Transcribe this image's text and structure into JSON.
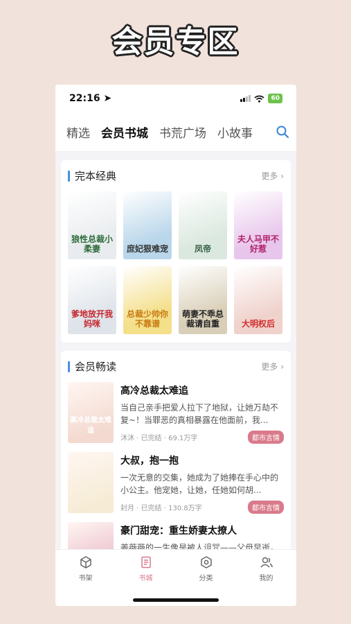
{
  "banner": "会员专区",
  "status": {
    "time": "22:16",
    "battery": "60"
  },
  "tabs": [
    "精选",
    "会员书城",
    "书荒广场",
    "小故事"
  ],
  "section1": {
    "title": "完本经典",
    "more": "更多",
    "books": [
      {
        "title": "狼性总裁小柔妻",
        "bg": "#e9ecef",
        "color": "#2c6b3a"
      },
      {
        "title": "庶妃狠难宠",
        "bg": "#b9d6ea",
        "color": "#333"
      },
      {
        "title": "凤帝",
        "bg": "#dbe8df",
        "color": "#355f45"
      },
      {
        "title": "夫人马甲不好惹",
        "bg": "#e8c6ec",
        "color": "#b0246a"
      },
      {
        "title": "爹地放开我妈咪",
        "bg": "#dfe4ea",
        "color": "#c6262e"
      },
      {
        "title": "总裁少帅你不靠谱",
        "bg": "#f4df8a",
        "color": "#c77b12"
      },
      {
        "title": "萌妻不乖总裁请自重",
        "bg": "#d9cfb8",
        "color": "#222"
      },
      {
        "title": "大明权后",
        "bg": "#f0d2cc",
        "color": "#d12f2f"
      }
    ]
  },
  "section2": {
    "title": "会员畅读",
    "more": "更多",
    "items": [
      {
        "title": "高冷总裁太难追",
        "desc": "当自己亲手把爱人拉下了地狱，让她万劫不复~！当罪恶的真相暴露在他面前，我...",
        "author": "沐沐",
        "status": "已完结",
        "words": "69.1万字",
        "tag": "都市言情",
        "cover_bg": "#f3d9cf",
        "cover_text": "高冷总裁太难追"
      },
      {
        "title": "大叔，抱一抱",
        "desc": "一次无意的交集，她成为了她捧在手心中的小公主。他宠她，让她，任她如何胡...",
        "author": "封月",
        "status": "已完结",
        "words": "130.8万字",
        "tag": "都市言情",
        "cover_bg": "#f6ecd6",
        "cover_text": ""
      },
      {
        "title": "豪门甜宠：重生娇妻太撩人",
        "desc": "姜薇薇的一生像是被人诅咒——父母早逝，亲人背叛，跌连最爱的男人都在骗她。",
        "author": "",
        "status": "",
        "words": "",
        "tag": "",
        "cover_bg": "#e9b7c8",
        "cover_text": ""
      }
    ]
  },
  "tabbar": [
    {
      "label": "书架",
      "icon": "cube-icon"
    },
    {
      "label": "书城",
      "icon": "book-icon"
    },
    {
      "label": "分类",
      "icon": "category-icon"
    },
    {
      "label": "我的",
      "icon": "user-icon"
    }
  ]
}
